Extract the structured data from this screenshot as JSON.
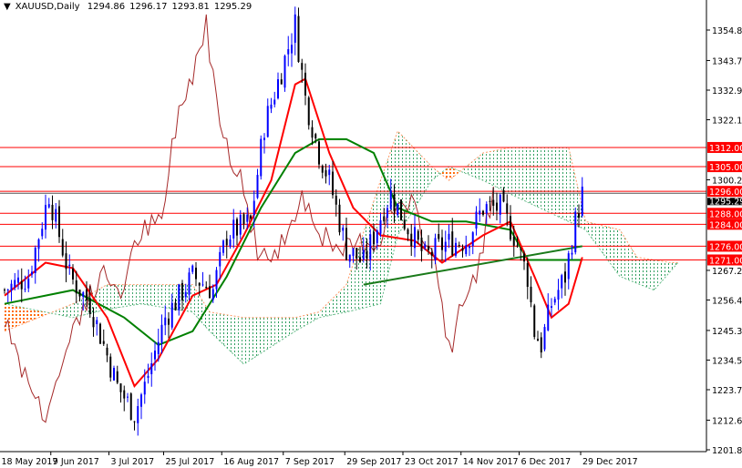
{
  "header": {
    "symbol": "XAUUSD,Daily",
    "open": "1294.86",
    "high": "1296.17",
    "low": "1293.81",
    "close": "1295.29"
  },
  "chart_data": {
    "type": "candlestick",
    "title": "XAUUSD,Daily",
    "ylim": [
      1201.8,
      1354.8
    ],
    "y_ticks": [
      "1354.80",
      "1343.70",
      "1332.90",
      "1322.10",
      "1300.20",
      "1267.20",
      "1256.40",
      "1245.30",
      "1234.50",
      "1223.70",
      "1212.60",
      "1201.80"
    ],
    "x_ticks": [
      {
        "label": "18 May 2017",
        "bar": 6
      },
      {
        "label": "9 Jun 2017",
        "bar": 21
      },
      {
        "label": "3 Jul 2017",
        "bar": 38
      },
      {
        "label": "25 Jul 2017",
        "bar": 54
      },
      {
        "label": "16 Aug 2017",
        "bar": 71
      },
      {
        "label": "7 Sep 2017",
        "bar": 89
      },
      {
        "label": "29 Sep 2017",
        "bar": 107
      },
      {
        "label": "23 Oct 2017",
        "bar": 124
      },
      {
        "label": "14 Nov 2017",
        "bar": 141
      },
      {
        "label": "6 Dec 2017",
        "bar": 158
      },
      {
        "label": "29 Dec 2017",
        "bar": 176
      }
    ],
    "price_path": [
      [
        0,
        1260
      ],
      [
        7,
        1265
      ],
      [
        12,
        1290
      ],
      [
        13,
        1295
      ],
      [
        19,
        1265
      ],
      [
        25,
        1255
      ],
      [
        33,
        1225
      ],
      [
        38,
        1215
      ],
      [
        41,
        1225
      ],
      [
        47,
        1250
      ],
      [
        55,
        1265
      ],
      [
        61,
        1260
      ],
      [
        65,
        1280
      ],
      [
        72,
        1285
      ],
      [
        76,
        1320
      ],
      [
        81,
        1340
      ],
      [
        85,
        1357
      ],
      [
        88,
        1330
      ],
      [
        92,
        1310
      ],
      [
        95,
        1300
      ],
      [
        100,
        1275
      ],
      [
        105,
        1270
      ],
      [
        111,
        1290
      ],
      [
        113,
        1295
      ],
      [
        117,
        1285
      ],
      [
        123,
        1272
      ],
      [
        129,
        1277
      ],
      [
        135,
        1278
      ],
      [
        140,
        1290
      ],
      [
        145,
        1290
      ],
      [
        149,
        1280
      ],
      [
        153,
        1265
      ],
      [
        155,
        1245
      ],
      [
        157,
        1240
      ],
      [
        160,
        1255
      ],
      [
        164,
        1265
      ],
      [
        167,
        1285
      ],
      [
        169,
        1295
      ]
    ],
    "tenkan": [
      [
        0,
        1258
      ],
      [
        12,
        1270
      ],
      [
        20,
        1268
      ],
      [
        30,
        1250
      ],
      [
        38,
        1225
      ],
      [
        45,
        1235
      ],
      [
        55,
        1258
      ],
      [
        62,
        1262
      ],
      [
        70,
        1280
      ],
      [
        78,
        1300
      ],
      [
        85,
        1335
      ],
      [
        88,
        1337
      ],
      [
        95,
        1310
      ],
      [
        102,
        1290
      ],
      [
        110,
        1280
      ],
      [
        120,
        1278
      ],
      [
        128,
        1270
      ],
      [
        140,
        1280
      ],
      [
        148,
        1285
      ],
      [
        155,
        1265
      ],
      [
        160,
        1250
      ],
      [
        165,
        1255
      ],
      [
        169,
        1272
      ]
    ],
    "kijun": [
      [
        0,
        1255
      ],
      [
        20,
        1260
      ],
      [
        35,
        1250
      ],
      [
        45,
        1240
      ],
      [
        55,
        1245
      ],
      [
        65,
        1265
      ],
      [
        75,
        1290
      ],
      [
        85,
        1310
      ],
      [
        92,
        1315
      ],
      [
        100,
        1315
      ],
      [
        108,
        1310
      ],
      [
        115,
        1290
      ],
      [
        125,
        1285
      ],
      [
        135,
        1285
      ],
      [
        148,
        1282
      ],
      [
        153,
        1271
      ],
      [
        169,
        1271
      ]
    ],
    "span_a": [
      [
        0,
        1245
      ],
      [
        20,
        1255
      ],
      [
        30,
        1262
      ],
      [
        40,
        1262
      ],
      [
        55,
        1262
      ],
      [
        60,
        1252
      ],
      [
        70,
        1250
      ],
      [
        85,
        1250
      ],
      [
        92,
        1252
      ],
      [
        100,
        1262
      ],
      [
        110,
        1300
      ],
      [
        115,
        1318
      ],
      [
        125,
        1305
      ],
      [
        130,
        1300
      ],
      [
        140,
        1310
      ],
      [
        148,
        1312
      ],
      [
        165,
        1312
      ],
      [
        170,
        1285
      ],
      [
        180,
        1282
      ],
      [
        185,
        1272
      ],
      [
        195,
        1270
      ],
      [
        197,
        1270
      ]
    ],
    "span_b": [
      [
        0,
        1255
      ],
      [
        20,
        1250
      ],
      [
        30,
        1253
      ],
      [
        40,
        1255
      ],
      [
        55,
        1252
      ],
      [
        60,
        1245
      ],
      [
        70,
        1233
      ],
      [
        85,
        1245
      ],
      [
        92,
        1250
      ],
      [
        100,
        1252
      ],
      [
        110,
        1255
      ],
      [
        115,
        1280
      ],
      [
        125,
        1300
      ],
      [
        130,
        1305
      ],
      [
        140,
        1300
      ],
      [
        148,
        1295
      ],
      [
        165,
        1285
      ],
      [
        170,
        1282
      ],
      [
        180,
        1265
      ],
      [
        190,
        1260
      ],
      [
        197,
        1270
      ]
    ],
    "trendline": [
      [
        105,
        1262
      ],
      [
        169,
        1276
      ]
    ],
    "levels": [
      {
        "price": 1312,
        "label": "1312.00"
      },
      {
        "price": 1305,
        "label": "1305.00"
      },
      {
        "price": 1296,
        "label": "1296.00"
      },
      {
        "price": 1288,
        "label": "1288.00"
      },
      {
        "price": 1284,
        "label": "1284.00"
      },
      {
        "price": 1276,
        "label": "1276.00"
      },
      {
        "price": 1271,
        "label": "1271.00"
      }
    ],
    "current_price": {
      "price": 1295.29,
      "label": "1295.29"
    },
    "colors": {
      "level": "#ff0000",
      "tenkan": "#ff0000",
      "kijun": "#008000",
      "chikou": "#a52a2a",
      "cloud_up": "#3cb371",
      "cloud_down": "#ff6600",
      "bull": "#0000ff",
      "bear": "#000000"
    }
  }
}
